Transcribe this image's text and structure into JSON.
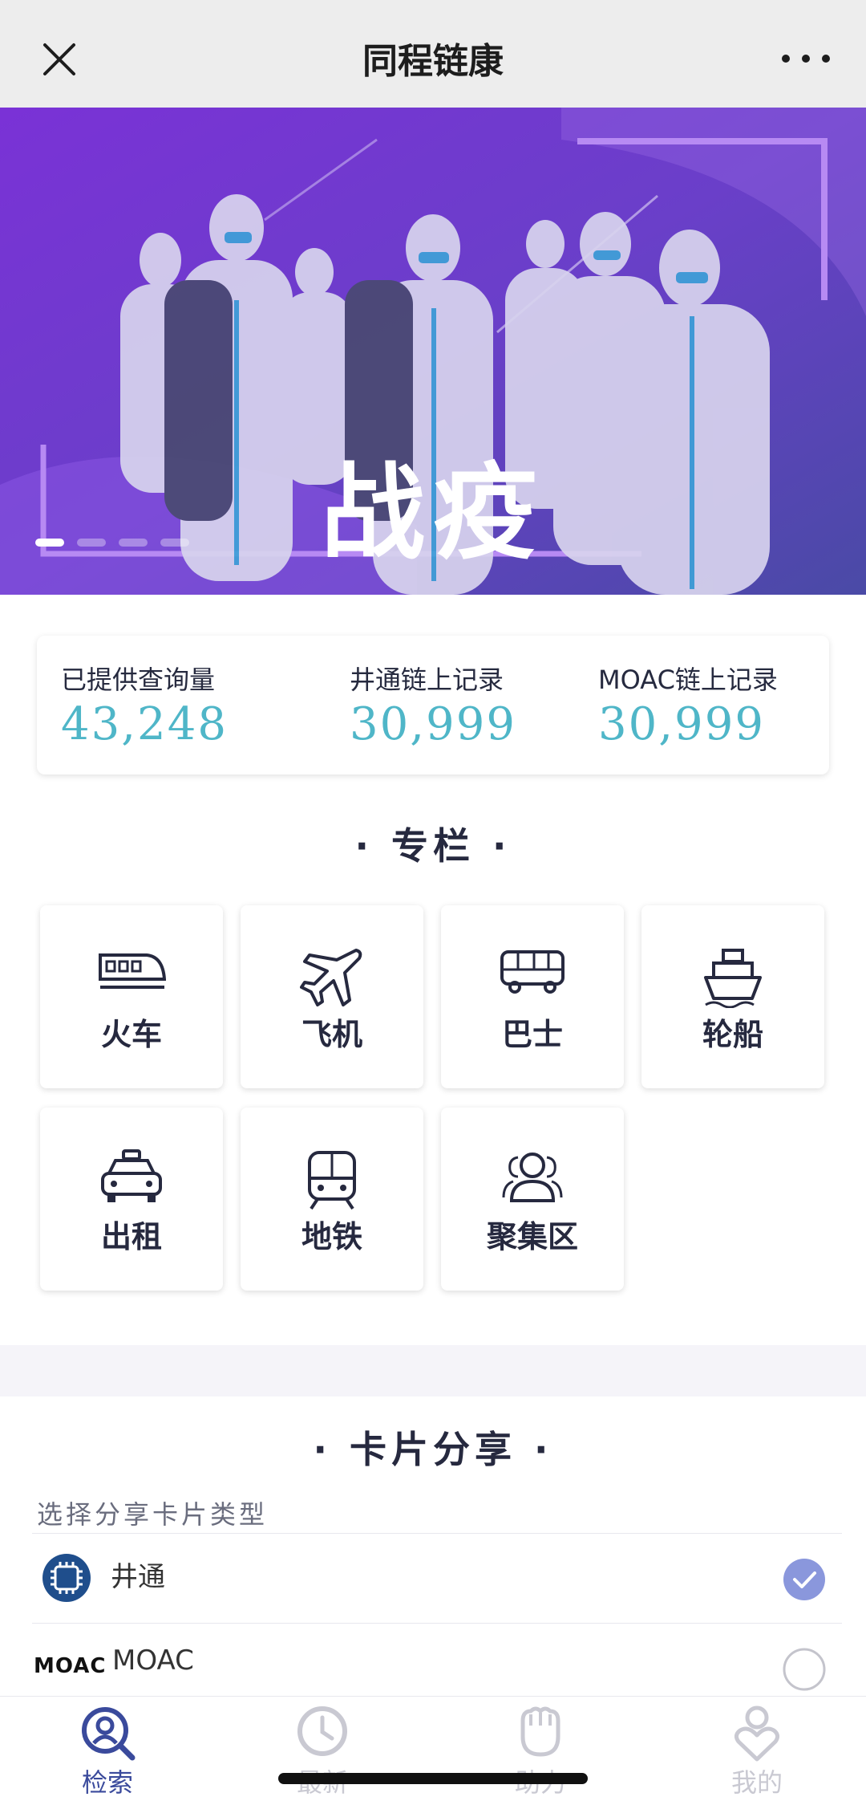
{
  "topbar": {
    "title": "同程链康"
  },
  "banner": {
    "headline": "战疫",
    "slides": 4,
    "active_slide": 0
  },
  "stats": [
    {
      "label": "已提供查询量",
      "value": "43,248"
    },
    {
      "label": "井通链上记录",
      "value": "30,999"
    },
    {
      "label": "MOAC链上记录",
      "value": "30,999"
    }
  ],
  "column": {
    "title": "· 专栏 ·",
    "items": [
      {
        "label": "火车",
        "icon": "train-icon"
      },
      {
        "label": "飞机",
        "icon": "plane-icon"
      },
      {
        "label": "巴士",
        "icon": "bus-icon"
      },
      {
        "label": "轮船",
        "icon": "ship-icon"
      },
      {
        "label": "出租",
        "icon": "taxi-icon"
      },
      {
        "label": "地铁",
        "icon": "metro-icon"
      },
      {
        "label": "聚集区",
        "icon": "crowd-icon"
      }
    ]
  },
  "share": {
    "title": "· 卡片分享 ·",
    "subtitle": "选择分享卡片类型",
    "options": [
      {
        "label": "井通",
        "selected": true
      },
      {
        "label": "MOAC",
        "logo_text": "MOAC",
        "selected": false
      }
    ]
  },
  "tabs": [
    {
      "label": "检索",
      "icon": "search-user-icon",
      "active": true
    },
    {
      "label": "最新",
      "icon": "clock-icon",
      "active": false
    },
    {
      "label": "助力",
      "icon": "fist-icon",
      "active": false
    },
    {
      "label": "我的",
      "icon": "profile-icon",
      "active": false
    }
  ],
  "colors": {
    "accent": "#4fb6c8",
    "active_tab": "#3a4a9c",
    "inactive_tab": "#c9c9d2",
    "check": "#8a97dc"
  }
}
